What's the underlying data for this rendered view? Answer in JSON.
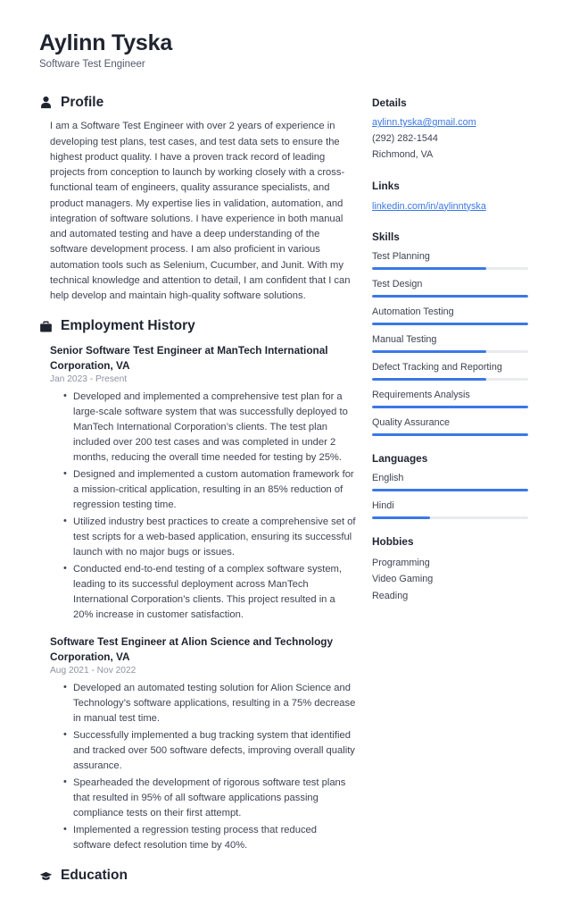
{
  "header": {
    "name": "Aylinn Tyska",
    "title": "Software Test Engineer"
  },
  "main": {
    "profile": {
      "icon": "person-icon",
      "title": "Profile",
      "text": "I am a Software Test Engineer with over 2 years of experience in developing test plans, test cases, and test data sets to ensure the highest product quality. I have a proven track record of leading projects from conception to launch by working closely with a cross-functional team of engineers, quality assurance specialists, and product managers. My expertise lies in validation, automation, and integration of software solutions. I have experience in both manual and automated testing and have a deep understanding of the software development process. I am also proficient in various automation tools such as Selenium, Cucumber, and Junit. With my technical knowledge and attention to detail, I am confident that I can help develop and maintain high-quality software solutions."
    },
    "employment": {
      "icon": "briefcase-icon",
      "title": "Employment History",
      "jobs": [
        {
          "heading": "Senior Software Test Engineer at ManTech International Corporation, VA",
          "date": "Jan 2023 - Present",
          "bullets": [
            "Developed and implemented a comprehensive test plan for a large-scale software system that was successfully deployed to ManTech International Corporation’s clients. The test plan included over 200 test cases and was completed in under 2 months, reducing the overall time needed for testing by 25%.",
            "Designed and implemented a custom automation framework for a mission-critical application, resulting in an 85% reduction of regression testing time.",
            "Utilized industry best practices to create a comprehensive set of test scripts for a web-based application, ensuring its successful launch with no major bugs or issues.",
            "Conducted end-to-end testing of a complex software system, leading to its successful deployment across ManTech International Corporation’s clients. This project resulted in a 20% increase in customer satisfaction."
          ]
        },
        {
          "heading": "Software Test Engineer at Alion Science and Technology Corporation, VA",
          "date": "Aug 2021 - Nov 2022",
          "bullets": [
            "Developed an automated testing solution for Alion Science and Technology’s software applications, resulting in a 75% decrease in manual test time.",
            "Successfully implemented a bug tracking system that identified and tracked over 500 software defects, improving overall quality assurance.",
            "Spearheaded the development of rigorous software test plans that resulted in 95% of all software applications passing compliance tests on their first attempt.",
            "Implemented a regression testing process that reduced software defect resolution time by 40%."
          ]
        }
      ]
    },
    "education": {
      "icon": "graduation-cap-icon",
      "title": "Education"
    }
  },
  "sidebar": {
    "details": {
      "title": "Details",
      "email": "aylinn.tyska@gmail.com",
      "phone": "(292) 282-1544",
      "location": "Richmond, VA"
    },
    "links": {
      "title": "Links",
      "items": [
        {
          "label": "linkedin.com/in/aylinntyska"
        }
      ]
    },
    "skills": {
      "title": "Skills",
      "items": [
        {
          "label": "Test Planning",
          "level": 73
        },
        {
          "label": "Test Design",
          "level": 100
        },
        {
          "label": "Automation Testing",
          "level": 100
        },
        {
          "label": "Manual Testing",
          "level": 73
        },
        {
          "label": "Defect Tracking and Reporting",
          "level": 73
        },
        {
          "label": "Requirements Analysis",
          "level": 100
        },
        {
          "label": "Quality Assurance",
          "level": 100
        }
      ]
    },
    "languages": {
      "title": "Languages",
      "items": [
        {
          "label": "English",
          "level": 100
        },
        {
          "label": "Hindi",
          "level": 37
        }
      ]
    },
    "hobbies": {
      "title": "Hobbies",
      "items": [
        {
          "label": "Programming"
        },
        {
          "label": "Video Gaming"
        },
        {
          "label": "Reading"
        }
      ]
    }
  },
  "colors": {
    "accent": "#3b78e7",
    "track": "#e9ebef",
    "heading": "#1f2430",
    "body": "#3d4352",
    "muted": "#8c93a1"
  }
}
